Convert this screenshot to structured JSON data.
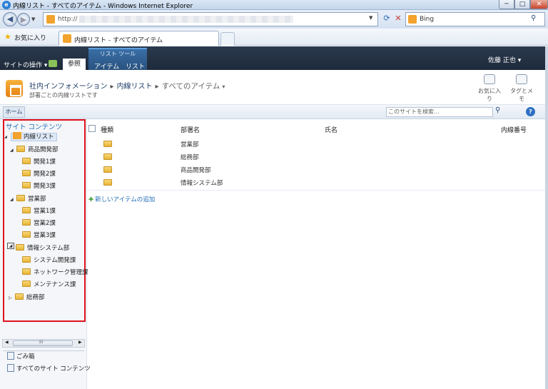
{
  "window": {
    "title": "内線リスト - すべてのアイテム - Windows Internet Explorer",
    "min_label": "─",
    "max_label": "□",
    "close_label": "✕"
  },
  "browser": {
    "address_prefix": "http://",
    "search_provider": "Bing",
    "favorites_label": "お気に入り",
    "tab_title": "内線リスト - すべてのアイテム"
  },
  "ribbon": {
    "site_actions": "サイトの操作 ▾",
    "browse_tab": "参照",
    "list_tools_label": "リスト ツール",
    "items_tab": "アイテム",
    "list_tab": "リスト",
    "user_name": "佐藤 正也 ▾"
  },
  "titlearea": {
    "breadcrumb": [
      "社内インフォメーション",
      "内線リスト",
      "すべてのアイテム"
    ],
    "current_suffix": "▾",
    "description": "部署ごとの内線リストです",
    "like_label": "お気に入り",
    "tags_label": "タグとメモ"
  },
  "topnav": {
    "home_tab": "ホーム",
    "search_placeholder": "このサイトを検索..."
  },
  "quicklaunch": {
    "title": "サイト コンテンツ",
    "list_name": "内線リスト",
    "tree": [
      {
        "label": "商品開発部",
        "arrow": "◢",
        "children": [
          "開発1課",
          "開発2課",
          "開発3課"
        ]
      },
      {
        "label": "営業部",
        "arrow": "◢",
        "children": [
          "営業1課",
          "営業2課",
          "営業3課"
        ]
      },
      {
        "label": "情報システム部",
        "arrow": "◢",
        "children": [
          "システム開発課",
          "ネットワーク管理課",
          "メンテナンス課"
        ]
      },
      {
        "label": "総務部",
        "arrow": "▷",
        "children": []
      }
    ],
    "scroll_mark": "III",
    "recycle_bin": "ごみ箱",
    "all_site_content": "すべてのサイト コンテンツ"
  },
  "list": {
    "columns": [
      "種類",
      "部署名",
      "氏名",
      "内線番号"
    ],
    "rows": [
      "営業部",
      "総務部",
      "商品開発部",
      "情報システム部"
    ],
    "add_item": "新しいアイテムの追加"
  }
}
